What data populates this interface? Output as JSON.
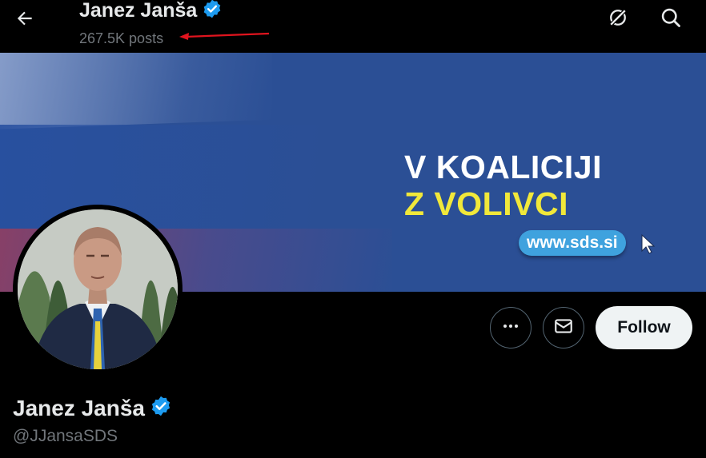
{
  "header": {
    "name": "Janez Janša",
    "posts_count": "267.5K posts",
    "icons": [
      "back-arrow-icon",
      "verified-badge-icon",
      "grok-icon",
      "search-icon"
    ],
    "annotation_color": "#e0141e"
  },
  "banner": {
    "line1": "V KOALICIJI",
    "line2": "Z VOLIVCI",
    "website": "www.sds.si",
    "colors": {
      "background": "#2b4f95",
      "line1": "#ffffff",
      "line2": "#f1e83a",
      "pill": "#3fa2de"
    }
  },
  "actions": {
    "more_icon": "more-horizontal-icon",
    "message_icon": "envelope-icon",
    "follow_label": "Follow"
  },
  "profile": {
    "name": "Janez Janša",
    "handle": "@JJansaSDS",
    "verified_color": "#1d9bf0"
  }
}
